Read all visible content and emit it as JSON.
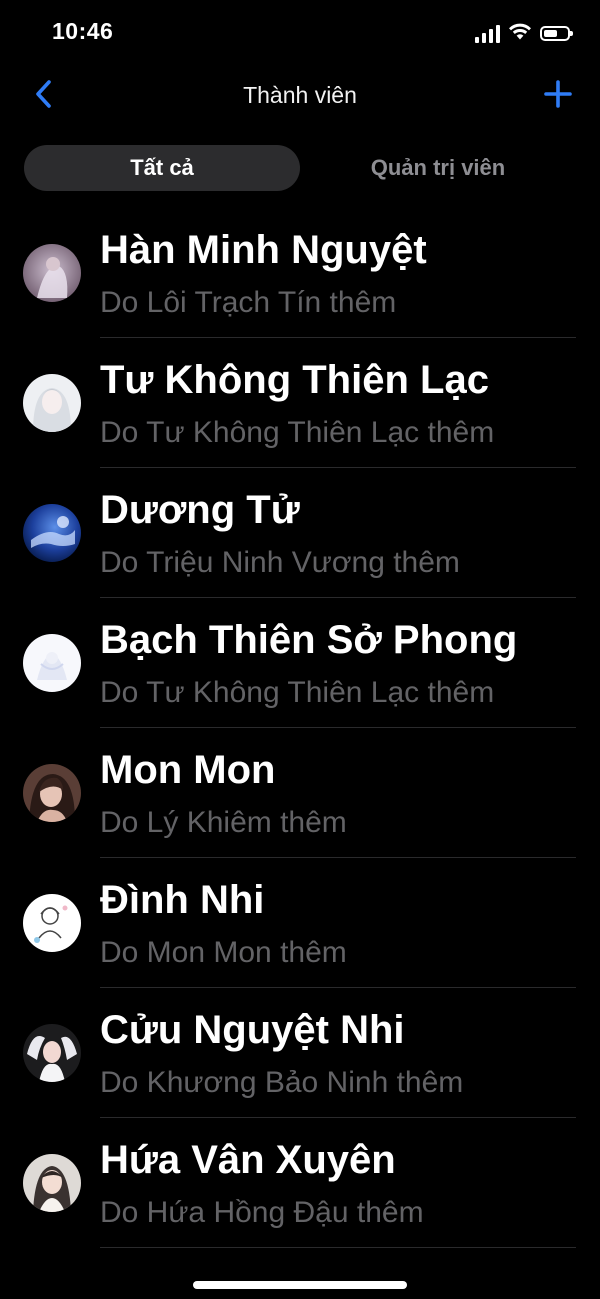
{
  "status_bar": {
    "time": "10:46",
    "icons": [
      "cellular-signal-icon",
      "wifi-icon",
      "battery-icon"
    ]
  },
  "nav": {
    "title": "Thành viên",
    "back_icon": "chevron-left-icon",
    "add_icon": "plus-icon",
    "accent_color": "#2f7cf6"
  },
  "segments": [
    {
      "label": "Tất cả",
      "selected": true
    },
    {
      "label": "Quản trị viên",
      "selected": false
    }
  ],
  "members": [
    {
      "name": "Hàn Minh Nguyệt",
      "added_by": "Do Lôi Trạch Tín thêm"
    },
    {
      "name": "Tư Không Thiên Lạc",
      "added_by": "Do Tư Không Thiên Lạc thêm"
    },
    {
      "name": "Dương Tử",
      "added_by": "Do Triệu Ninh Vương thêm"
    },
    {
      "name": "Bạch Thiên Sở Phong",
      "added_by": "Do Tư Không Thiên Lạc thêm"
    },
    {
      "name": "Mon Mon",
      "added_by": "Do Lý Khiêm thêm"
    },
    {
      "name": "Đình Nhi",
      "added_by": "Do Mon Mon thêm"
    },
    {
      "name": "Cửu Nguyệt Nhi",
      "added_by": "Do Khương Bảo Ninh thêm"
    },
    {
      "name": "Hứa Vân Xuyên",
      "added_by": "Do Hứa Hồng Đậu thêm"
    }
  ],
  "colors": {
    "background": "#000000",
    "primary_text": "#ffffff",
    "secondary_text": "#636366",
    "segment_active_bg": "#2c2c2e",
    "segment_inactive_text": "#8e8e93"
  }
}
